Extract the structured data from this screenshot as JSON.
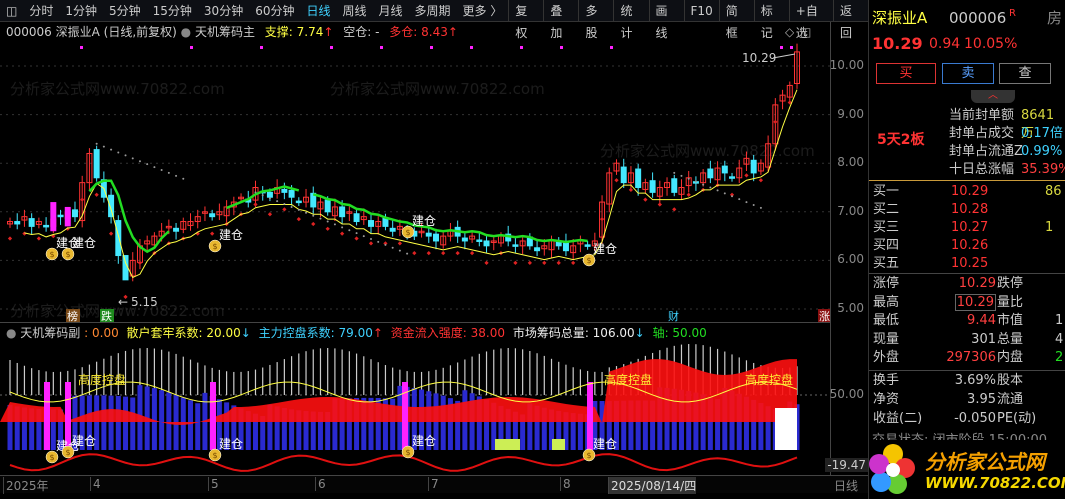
{
  "toolbar": {
    "periods": [
      "分时",
      "1分钟",
      "5分钟",
      "15分钟",
      "30分钟",
      "60分钟",
      "日线",
      "周线",
      "月线",
      "多周期",
      "更多 〉"
    ],
    "active_period": "日线",
    "buttons": [
      "复权",
      "叠加",
      "多股",
      "统计",
      "画线",
      "F10",
      "简框",
      "标记",
      "+自选",
      "返回"
    ]
  },
  "info": {
    "title": "000006 深振业A (日线,前复权)",
    "indicator": "天机筹码主",
    "support_label": "支撑: 7.74",
    "empty_label": "空仓: -",
    "long_label": "多仓: 8.43"
  },
  "watermark": "分析家公式网www.70822.com",
  "price_axis": [
    "10.00",
    "9.00",
    "8.00",
    "7.00",
    "6.00",
    "5.00"
  ],
  "annotations": {
    "high": "10.29",
    "low": "5.15",
    "jian_cang": "建仓",
    "bang": "榜",
    "die": "跌",
    "cai": "财",
    "zhang": "涨",
    "gaodu": "高度控盘"
  },
  "colors": {
    "up": "#ff3333",
    "down": "#44e8ff",
    "yellow": "#ffff44",
    "green": "#22dd22",
    "magenta": "#ff22ff"
  },
  "chart_data": {
    "type": "candlestick",
    "closes": [
      6.8,
      6.75,
      6.9,
      6.7,
      6.8,
      6.7,
      6.85,
      6.9,
      7.0,
      6.9,
      7.6,
      8.2,
      7.7,
      7.3,
      6.9,
      6.1,
      5.6,
      6.0,
      6.3,
      6.4,
      6.5,
      6.6,
      6.7,
      6.6,
      6.8,
      6.8,
      6.9,
      7.0,
      6.9,
      7.0,
      7.1,
      7.2,
      7.3,
      7.2,
      7.5,
      7.4,
      7.3,
      7.5,
      7.4,
      7.3,
      7.2,
      7.3,
      7.1,
      7.2,
      7.0,
      7.1,
      6.9,
      7.0,
      6.8,
      6.9,
      6.7,
      6.8,
      6.7,
      6.6,
      6.7,
      6.6,
      6.5,
      6.6,
      6.5,
      6.4,
      6.5,
      6.6,
      6.5,
      6.4,
      6.5,
      6.4,
      6.3,
      6.4,
      6.5,
      6.4,
      6.3,
      6.4,
      6.3,
      6.2,
      6.3,
      6.4,
      6.3,
      6.2,
      6.3,
      6.4,
      6.3,
      6.4,
      7.2,
      7.8,
      8.0,
      7.6,
      7.8,
      7.5,
      7.6,
      7.4,
      7.5,
      7.6,
      7.4,
      7.5,
      7.7,
      7.6,
      7.8,
      7.7,
      7.9,
      7.8,
      7.7,
      7.9,
      8.1,
      7.8,
      8.0,
      8.4,
      9.2,
      9.4,
      9.6,
      10.29
    ],
    "ylim": [
      4.8,
      10.5
    ]
  },
  "indicator": {
    "name": "天机筹码副",
    "v0": ": 0.00",
    "retail": "散户套牢系数: 20.00",
    "main": "主力控盘系数: 79.00",
    "flow": "资金流入强度: 38.00",
    "total": "市场筹码总量: 106.00",
    "axis": "轴: 50.00",
    "axis_ticks": [
      "50.00",
      "-19.47"
    ]
  },
  "dates": {
    "labels": [
      "2025年",
      "4",
      "5",
      "6",
      "7",
      "8"
    ],
    "cursor": "2025/08/14/四",
    "period": "日线"
  },
  "quote": {
    "name": "深振业A",
    "code": "000006",
    "r_badge": "R",
    "fang": "房",
    "price": "10.29",
    "change": "0.94",
    "pct": "10.05%",
    "buy": "买",
    "sell": "卖",
    "check": "查",
    "boards": "5天2板",
    "seal_stats": [
      {
        "label": "当前封单额",
        "value": "8641万",
        "color": "#d8d840"
      },
      {
        "label": "封单占成交",
        "value": "0.17倍",
        "color": "#3fd2ff"
      },
      {
        "label": "封单占流通Z",
        "value": "0.99%",
        "color": "#3fd2ff"
      },
      {
        "label": "十日总涨幅",
        "value": "35.39%",
        "color": "#ff4040"
      }
    ],
    "bids": [
      {
        "label": "买一",
        "price": "10.29",
        "vol": "86"
      },
      {
        "label": "买二",
        "price": "10.28",
        "vol": ""
      },
      {
        "label": "买三",
        "price": "10.27",
        "vol": "1"
      },
      {
        "label": "买四",
        "price": "10.26",
        "vol": ""
      },
      {
        "label": "买五",
        "price": "10.25",
        "vol": ""
      }
    ],
    "stats": [
      {
        "l": "涨停",
        "v": "10.29",
        "c": "#ff4040",
        "l2": "跌停",
        "v2": ""
      },
      {
        "l": "最高",
        "v": "10.29",
        "c": "#ff4040",
        "l2": "量比",
        "v2": ""
      },
      {
        "l": "最低",
        "v": "9.44",
        "c": "#ff4040",
        "l2": "市值",
        "v2": "1"
      },
      {
        "l": "现量",
        "v": "301",
        "c": "#ccc",
        "l2": "总量",
        "v2": "4"
      },
      {
        "l": "外盘",
        "v": "297306",
        "c": "#ff4040",
        "l2": "内盘",
        "v2": "2"
      }
    ],
    "fin": [
      {
        "l": "换手",
        "v": "3.69%",
        "l2": "股本"
      },
      {
        "l": "净资",
        "v": "3.95",
        "l2": "流通"
      },
      {
        "l": "收益(二)",
        "v": "-0.050",
        "l2": "PE(动)"
      }
    ],
    "status": "交易状态: 闭市阶段 15:00:00",
    "logo_cn": "分析家公式网",
    "logo_url": "WWW.70822.COM"
  }
}
